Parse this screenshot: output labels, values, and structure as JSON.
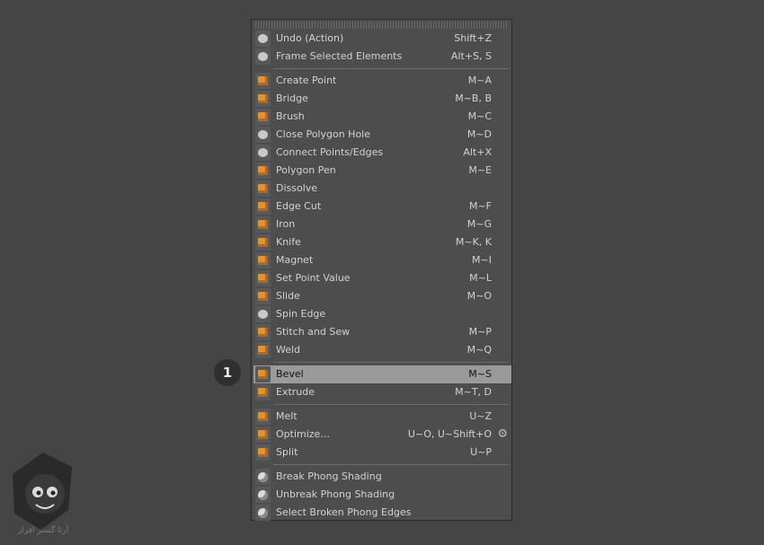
{
  "menu": {
    "groups": [
      [
        {
          "label": "Undo (Action)",
          "shortcut": "Shift+Z",
          "icon": "undo-icon",
          "style": "gray"
        },
        {
          "label": "Frame Selected Elements",
          "shortcut": "Alt+S, S",
          "icon": "frame-selected-icon",
          "style": "gray"
        }
      ],
      [
        {
          "label": "Create Point",
          "shortcut": "M~A",
          "icon": "create-point-icon",
          "style": "orange"
        },
        {
          "label": "Bridge",
          "shortcut": "M~B, B",
          "icon": "bridge-icon",
          "style": "orange"
        },
        {
          "label": "Brush",
          "shortcut": "M~C",
          "icon": "brush-icon",
          "style": "orange"
        },
        {
          "label": "Close Polygon Hole",
          "shortcut": "M~D",
          "icon": "close-polygon-hole-icon",
          "style": "gray"
        },
        {
          "label": "Connect Points/Edges",
          "shortcut": "Alt+X",
          "icon": "connect-points-icon",
          "style": "gray"
        },
        {
          "label": "Polygon Pen",
          "shortcut": "M~E",
          "icon": "polygon-pen-icon",
          "style": "orange"
        },
        {
          "label": "Dissolve",
          "shortcut": "",
          "icon": "dissolve-icon",
          "style": "orange"
        },
        {
          "label": "Edge Cut",
          "shortcut": "M~F",
          "icon": "edge-cut-icon",
          "style": "orange"
        },
        {
          "label": "Iron",
          "shortcut": "M~G",
          "icon": "iron-icon",
          "style": "orange"
        },
        {
          "label": "Knife",
          "shortcut": "M~K, K",
          "icon": "knife-icon",
          "style": "orange"
        },
        {
          "label": "Magnet",
          "shortcut": "M~I",
          "icon": "magnet-icon",
          "style": "orange"
        },
        {
          "label": "Set Point Value",
          "shortcut": "M~L",
          "icon": "set-point-value-icon",
          "style": "orange"
        },
        {
          "label": "Slide",
          "shortcut": "M~O",
          "icon": "slide-icon",
          "style": "orange"
        },
        {
          "label": "Spin Edge",
          "shortcut": "",
          "icon": "spin-edge-icon",
          "style": "gray"
        },
        {
          "label": "Stitch and Sew",
          "shortcut": "M~P",
          "icon": "stitch-and-sew-icon",
          "style": "orange"
        },
        {
          "label": "Weld",
          "shortcut": "M~Q",
          "icon": "weld-icon",
          "style": "orange"
        }
      ],
      [
        {
          "label": "Bevel",
          "shortcut": "M~S",
          "icon": "bevel-icon",
          "style": "orange",
          "highlighted": true
        },
        {
          "label": "Extrude",
          "shortcut": "M~T, D",
          "icon": "extrude-icon",
          "style": "orange"
        }
      ],
      [
        {
          "label": "Melt",
          "shortcut": "U~Z",
          "icon": "melt-icon",
          "style": "orange"
        },
        {
          "label": "Optimize...",
          "shortcut": "U~O, U~Shift+O",
          "icon": "optimize-icon",
          "style": "orange",
          "gear": true
        },
        {
          "label": "Split",
          "shortcut": "U~P",
          "icon": "split-icon",
          "style": "orange"
        }
      ],
      [
        {
          "label": "Break Phong Shading",
          "shortcut": "",
          "icon": "break-phong-icon",
          "style": "white"
        },
        {
          "label": "Unbreak Phong Shading",
          "shortcut": "",
          "icon": "unbreak-phong-icon",
          "style": "white"
        },
        {
          "label": "Select Broken Phong Edges",
          "shortcut": "",
          "icon": "select-broken-phong-icon",
          "style": "white"
        }
      ]
    ]
  },
  "callout": {
    "number": "1"
  },
  "watermark": {
    "text": "آرتا گستر افراز"
  },
  "colors": {
    "accent": "#e8902a",
    "highlight": "#9a9a9a",
    "background": "#454545",
    "menu": "#4d4d4d"
  }
}
